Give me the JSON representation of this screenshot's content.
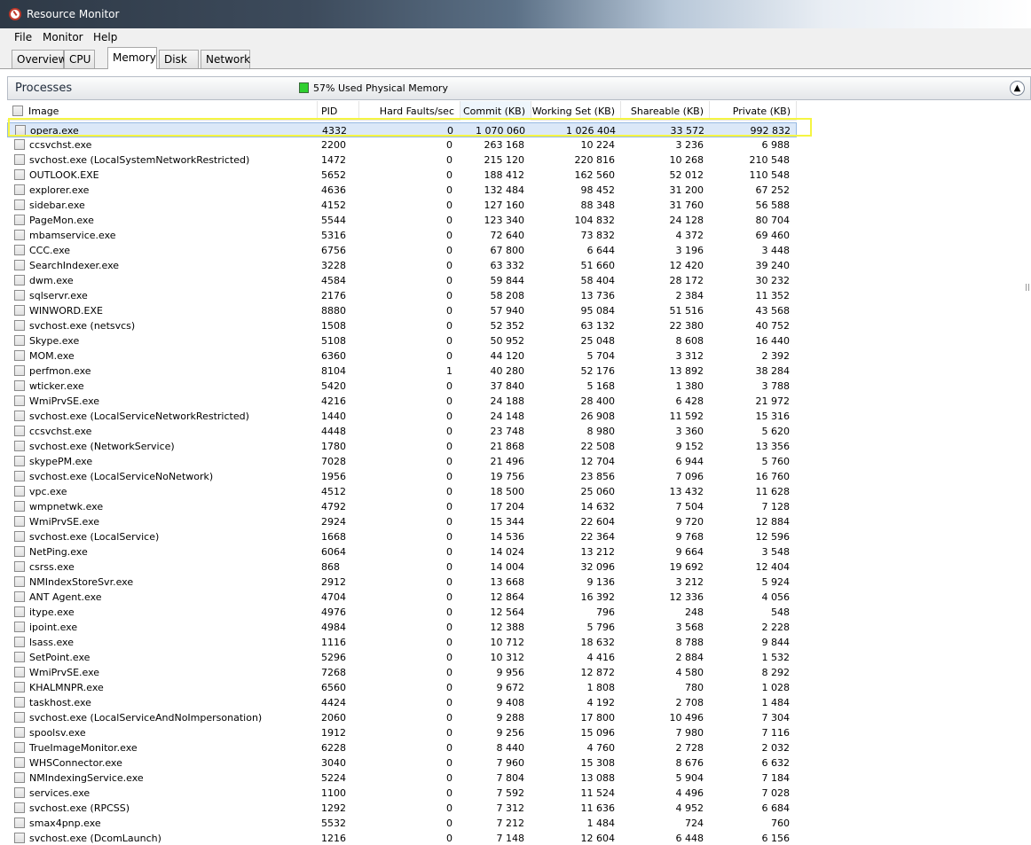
{
  "window": {
    "title": "Resource Monitor"
  },
  "menu": [
    "File",
    "Monitor",
    "Help"
  ],
  "tabs": [
    "Overview",
    "CPU",
    "Memory",
    "Disk",
    "Network"
  ],
  "active_tab": "Memory",
  "processes": {
    "title": "Processes",
    "memory_status": "57% Used Physical Memory",
    "memory_status_color": "#2fd02f",
    "collapse_icon": "chevron-up-icon",
    "columns": [
      "Image",
      "PID",
      "Hard Faults/sec",
      "Commit (KB)",
      "Working Set (KB)",
      "Shareable (KB)",
      "Private (KB)"
    ],
    "sorted_column": "Commit (KB)",
    "highlight_color": "#f5f542",
    "rows": [
      [
        "opera.exe",
        "4332",
        "0",
        "1 070 060",
        "1 026 404",
        "33 572",
        "992 832"
      ],
      [
        "ccsvchst.exe",
        "2200",
        "0",
        "263 168",
        "10 224",
        "3 236",
        "6 988"
      ],
      [
        "svchost.exe (LocalSystemNetworkRestricted)",
        "1472",
        "0",
        "215 120",
        "220 816",
        "10 268",
        "210 548"
      ],
      [
        "OUTLOOK.EXE",
        "5652",
        "0",
        "188 412",
        "162 560",
        "52 012",
        "110 548"
      ],
      [
        "explorer.exe",
        "4636",
        "0",
        "132 484",
        "98 452",
        "31 200",
        "67 252"
      ],
      [
        "sidebar.exe",
        "4152",
        "0",
        "127 160",
        "88 348",
        "31 760",
        "56 588"
      ],
      [
        "PageMon.exe",
        "5544",
        "0",
        "123 340",
        "104 832",
        "24 128",
        "80 704"
      ],
      [
        "mbamservice.exe",
        "5316",
        "0",
        "72 640",
        "73 832",
        "4 372",
        "69 460"
      ],
      [
        "CCC.exe",
        "6756",
        "0",
        "67 800",
        "6 644",
        "3 196",
        "3 448"
      ],
      [
        "SearchIndexer.exe",
        "3228",
        "0",
        "63 332",
        "51 660",
        "12 420",
        "39 240"
      ],
      [
        "dwm.exe",
        "4584",
        "0",
        "59 844",
        "58 404",
        "28 172",
        "30 232"
      ],
      [
        "sqlservr.exe",
        "2176",
        "0",
        "58 208",
        "13 736",
        "2 384",
        "11 352"
      ],
      [
        "WINWORD.EXE",
        "8880",
        "0",
        "57 940",
        "95 084",
        "51 516",
        "43 568"
      ],
      [
        "svchost.exe (netsvcs)",
        "1508",
        "0",
        "52 352",
        "63 132",
        "22 380",
        "40 752"
      ],
      [
        "Skype.exe",
        "5108",
        "0",
        "50 952",
        "25 048",
        "8 608",
        "16 440"
      ],
      [
        "MOM.exe",
        "6360",
        "0",
        "44 120",
        "5 704",
        "3 312",
        "2 392"
      ],
      [
        "perfmon.exe",
        "8104",
        "1",
        "40 280",
        "52 176",
        "13 892",
        "38 284"
      ],
      [
        "wticker.exe",
        "5420",
        "0",
        "37 840",
        "5 168",
        "1 380",
        "3 788"
      ],
      [
        "WmiPrvSE.exe",
        "4216",
        "0",
        "24 188",
        "28 400",
        "6 428",
        "21 972"
      ],
      [
        "svchost.exe (LocalServiceNetworkRestricted)",
        "1440",
        "0",
        "24 148",
        "26 908",
        "11 592",
        "15 316"
      ],
      [
        "ccsvchst.exe",
        "4448",
        "0",
        "23 748",
        "8 980",
        "3 360",
        "5 620"
      ],
      [
        "svchost.exe (NetworkService)",
        "1780",
        "0",
        "21 868",
        "22 508",
        "9 152",
        "13 356"
      ],
      [
        "skypePM.exe",
        "7028",
        "0",
        "21 496",
        "12 704",
        "6 944",
        "5 760"
      ],
      [
        "svchost.exe (LocalServiceNoNetwork)",
        "1956",
        "0",
        "19 756",
        "23 856",
        "7 096",
        "16 760"
      ],
      [
        "vpc.exe",
        "4512",
        "0",
        "18 500",
        "25 060",
        "13 432",
        "11 628"
      ],
      [
        "wmpnetwk.exe",
        "4792",
        "0",
        "17 204",
        "14 632",
        "7 504",
        "7 128"
      ],
      [
        "WmiPrvSE.exe",
        "2924",
        "0",
        "15 344",
        "22 604",
        "9 720",
        "12 884"
      ],
      [
        "svchost.exe (LocalService)",
        "1668",
        "0",
        "14 536",
        "22 364",
        "9 768",
        "12 596"
      ],
      [
        "NetPing.exe",
        "6064",
        "0",
        "14 024",
        "13 212",
        "9 664",
        "3 548"
      ],
      [
        "csrss.exe",
        "868",
        "0",
        "14 004",
        "32 096",
        "19 692",
        "12 404"
      ],
      [
        "NMIndexStoreSvr.exe",
        "2912",
        "0",
        "13 668",
        "9 136",
        "3 212",
        "5 924"
      ],
      [
        "ANT Agent.exe",
        "4704",
        "0",
        "12 864",
        "16 392",
        "12 336",
        "4 056"
      ],
      [
        "itype.exe",
        "4976",
        "0",
        "12 564",
        "796",
        "248",
        "548"
      ],
      [
        "ipoint.exe",
        "4984",
        "0",
        "12 388",
        "5 796",
        "3 568",
        "2 228"
      ],
      [
        "lsass.exe",
        "1116",
        "0",
        "10 712",
        "18 632",
        "8 788",
        "9 844"
      ],
      [
        "SetPoint.exe",
        "5296",
        "0",
        "10 312",
        "4 416",
        "2 884",
        "1 532"
      ],
      [
        "WmiPrvSE.exe",
        "7268",
        "0",
        "9 956",
        "12 872",
        "4 580",
        "8 292"
      ],
      [
        "KHALMNPR.exe",
        "6560",
        "0",
        "9 672",
        "1 808",
        "780",
        "1 028"
      ],
      [
        "taskhost.exe",
        "4424",
        "0",
        "9 408",
        "4 192",
        "2 708",
        "1 484"
      ],
      [
        "svchost.exe (LocalServiceAndNoImpersonation)",
        "2060",
        "0",
        "9 288",
        "17 800",
        "10 496",
        "7 304"
      ],
      [
        "spoolsv.exe",
        "1912",
        "0",
        "9 256",
        "15 096",
        "7 980",
        "7 116"
      ],
      [
        "TrueImageMonitor.exe",
        "6228",
        "0",
        "8 440",
        "4 760",
        "2 728",
        "2 032"
      ],
      [
        "WHSConnector.exe",
        "3040",
        "0",
        "7 960",
        "15 308",
        "8 676",
        "6 632"
      ],
      [
        "NMIndexingService.exe",
        "5224",
        "0",
        "7 804",
        "13 088",
        "5 904",
        "7 184"
      ],
      [
        "services.exe",
        "1100",
        "0",
        "7 592",
        "11 524",
        "4 496",
        "7 028"
      ],
      [
        "svchost.exe (RPCSS)",
        "1292",
        "0",
        "7 312",
        "11 636",
        "4 952",
        "6 684"
      ],
      [
        "smax4pnp.exe",
        "5532",
        "0",
        "7 212",
        "1 484",
        "724",
        "760"
      ],
      [
        "svchost.exe (DcomLaunch)",
        "1216",
        "0",
        "7 148",
        "12 604",
        "6 448",
        "6 156"
      ]
    ]
  }
}
